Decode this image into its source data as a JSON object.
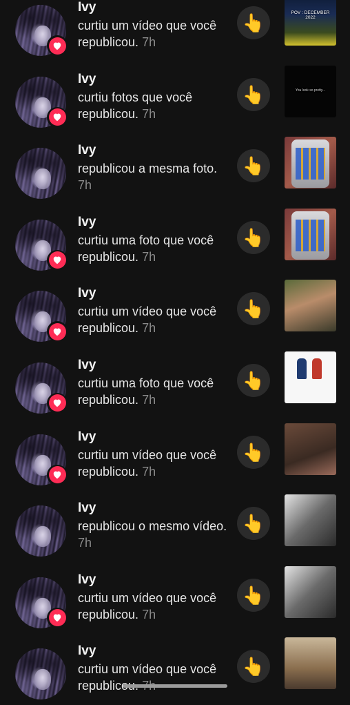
{
  "notifications": [
    {
      "name": "Ivy",
      "message": "curtiu um vídeo que você republicou.",
      "time": "7h",
      "thumb": "t-stadium",
      "caption": "POV : DECEMBER 2022",
      "badge": true
    },
    {
      "name": "Ivy",
      "message": "curtiu fotos que você republicou.",
      "time": "7h",
      "thumb": "t-black",
      "caption": "You look so pretty...",
      "badge": true
    },
    {
      "name": "Ivy",
      "message": "republicou a mesma foto.",
      "time": "7h",
      "thumb": "t-phone",
      "caption": "",
      "badge": false
    },
    {
      "name": "Ivy",
      "message": "curtiu uma foto que você republicou.",
      "time": "7h",
      "thumb": "t-phone",
      "caption": "",
      "badge": true
    },
    {
      "name": "Ivy",
      "message": "curtiu um vídeo que você republicou.",
      "time": "7h",
      "thumb": "t-woman",
      "caption": "",
      "badge": true
    },
    {
      "name": "Ivy",
      "message": "curtiu uma foto que você republicou.",
      "time": "7h",
      "thumb": "t-white",
      "caption": "",
      "badge": true
    },
    {
      "name": "Ivy",
      "message": "curtiu um vídeo que você republicou.",
      "time": "7h",
      "thumb": "t-dark-woman",
      "caption": "",
      "badge": true
    },
    {
      "name": "Ivy",
      "message": "republicou o mesmo vídeo.",
      "time": "7h",
      "thumb": "t-bw",
      "caption": "",
      "badge": false
    },
    {
      "name": "Ivy",
      "message": "curtiu um vídeo que você republicou.",
      "time": "7h",
      "thumb": "t-bw",
      "caption": "",
      "badge": true
    },
    {
      "name": "Ivy",
      "message": "curtiu um vídeo que você republicou.",
      "time": "7h",
      "thumb": "t-room",
      "caption": "",
      "badge": false
    }
  ],
  "reaction_icon": "👆",
  "heart_icon": "heart-icon",
  "colors": {
    "background": "#121212",
    "badge": "#fe2c55",
    "time": "#8a8a8a"
  }
}
